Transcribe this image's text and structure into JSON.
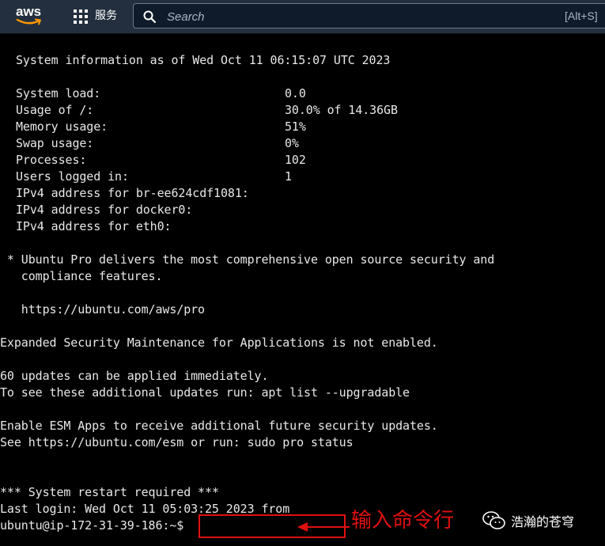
{
  "header": {
    "logo_text": "aws",
    "services_label": "服务",
    "search_placeholder": "Search",
    "search_shortcut": "[Alt+S]",
    "icons": [
      "aws-smile-logo",
      "grid-icon",
      "search-icon"
    ]
  },
  "terminal": {
    "sysinfo_title": "System information as of Wed Oct 11 06:15:07 UTC 2023",
    "stats": [
      {
        "label": "System load:",
        "value": "0.0"
      },
      {
        "label": "Usage of /:",
        "value": "30.0% of 14.36GB"
      },
      {
        "label": "Memory usage:",
        "value": "51%"
      },
      {
        "label": "Swap usage:",
        "value": "0%"
      },
      {
        "label": "Processes:",
        "value": "102"
      },
      {
        "label": "Users logged in:",
        "value": "1"
      },
      {
        "label": "IPv4 address for br-ee624cdf1081:",
        "value": ""
      },
      {
        "label": "IPv4 address for docker0:",
        "value": ""
      },
      {
        "label": "IPv4 address for eth0:",
        "value": ""
      }
    ],
    "pro_line1": " * Ubuntu Pro delivers the most comprehensive open source security and",
    "pro_line2": "   compliance features.",
    "pro_url": "   https://ubuntu.com/aws/pro",
    "esm_line": "Expanded Security Maintenance for Applications is not enabled.",
    "updates_line1": "60 updates can be applied immediately.",
    "updates_line2": "To see these additional updates run: apt list --upgradable",
    "esm_apps_line1": "Enable ESM Apps to receive additional future security updates.",
    "esm_apps_line2": "See https://ubuntu.com/esm or run: sudo pro status",
    "restart_line": "*** System restart required ***",
    "last_login": "Last login: Wed Oct 11 05:03:25 2023 from",
    "prompt": "ubuntu@ip-172-31-39-186:~$"
  },
  "annotation": {
    "text": "输入命令行",
    "color": "#e01010"
  },
  "watermark": {
    "text": "浩瀚的苍穹",
    "icon": "wechat-icon"
  }
}
